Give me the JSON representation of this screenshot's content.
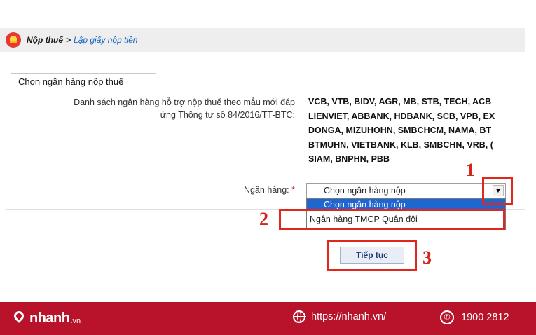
{
  "breadcrumb": {
    "home": "Nộp thuế",
    "separator": ">",
    "current": "Lập giấy nộp tiền"
  },
  "tab": {
    "label": "Chọn ngân hàng nộp thuế"
  },
  "form": {
    "supported_label_line1": "Danh sách ngân hàng hỗ trợ nộp thuế theo mẫu mới đáp",
    "supported_label_line2": "ứng Thông tư số 84/2016/TT-BTC:",
    "bank_lines": [
      "VCB, VTB, BIDV, AGR, MB, STB, TECH, ACB",
      "LIENVIET, ABBANK, HDBANK, SCB, VPB, EX",
      "DONGA, MIZUHOHN, SMBCHCM, NAMA, BT",
      "BTMUHN, VIETBANK, KLB, SMBCHN, VRB, (",
      "SIAM, BNPHN, PBB"
    ],
    "bank_label": "Ngân hàng:",
    "required_mark": "*",
    "select_value": "--- Chọn ngân hàng nộp ---",
    "select_arrow": "▼",
    "options": [
      "--- Chọn ngân hàng nộp ---",
      "Ngân hàng TMCP Quân đội"
    ],
    "submit_label": "Tiếp tục"
  },
  "annotations": {
    "m1": "1",
    "m2": "2",
    "m3": "3",
    "color": "#e0261d"
  },
  "footer": {
    "brand": "nhanh",
    "brand_suffix": ".vn",
    "website": "https://nhanh.vn/",
    "phone": "1900 2812",
    "phone_glyph": "✆",
    "background": "#b8132a"
  }
}
